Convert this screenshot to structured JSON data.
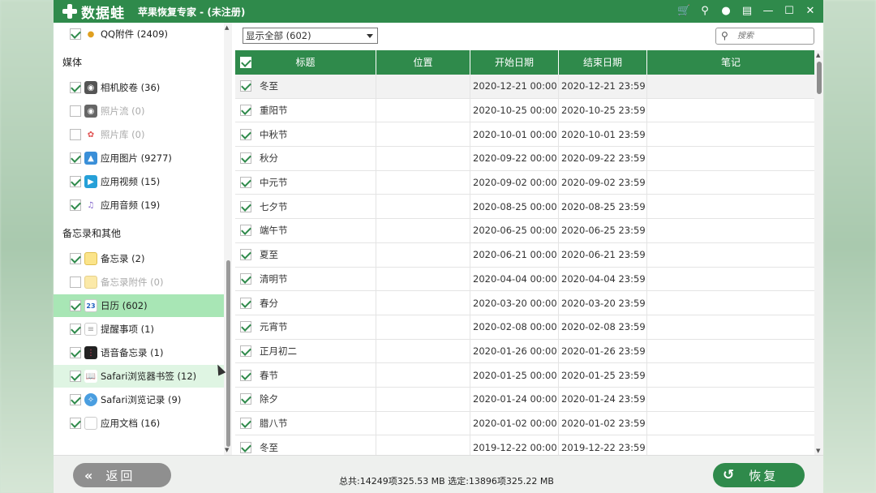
{
  "titlebar": {
    "logo_text": "数据蛙",
    "app_title": "苹果恢复专家 - (未注册)",
    "icons": [
      "cart-icon",
      "key-icon",
      "chat-icon",
      "feedback-icon",
      "minimize-icon",
      "maximize-icon",
      "close-icon"
    ]
  },
  "sidebar": {
    "qq_attachments": {
      "label": "QQ附件 (2409)",
      "checked": true
    },
    "media_header": "媒体",
    "media": [
      {
        "label": "相机胶卷 (36)",
        "checked": true,
        "disabled": false
      },
      {
        "label": "照片流 (0)",
        "checked": false,
        "disabled": true
      },
      {
        "label": "照片库 (0)",
        "checked": false,
        "disabled": true
      },
      {
        "label": "应用图片 (9277)",
        "checked": true,
        "disabled": false
      },
      {
        "label": "应用视频 (15)",
        "checked": true,
        "disabled": false
      },
      {
        "label": "应用音频 (19)",
        "checked": true,
        "disabled": false
      }
    ],
    "notes_header": "备忘录和其他",
    "notes": [
      {
        "label": "备忘录 (2)",
        "checked": true,
        "disabled": false
      },
      {
        "label": "备忘录附件 (0)",
        "checked": false,
        "disabled": true
      },
      {
        "label": "日历 (602)",
        "checked": true,
        "disabled": false,
        "selected": true
      },
      {
        "label": "提醒事项 (1)",
        "checked": true,
        "disabled": false
      },
      {
        "label": "语音备忘录 (1)",
        "checked": true,
        "disabled": false
      },
      {
        "label": "Safari浏览器书签 (12)",
        "checked": true,
        "disabled": false,
        "hover": true
      },
      {
        "label": "Safari浏览记录 (9)",
        "checked": true,
        "disabled": false
      },
      {
        "label": "应用文档 (16)",
        "checked": true,
        "disabled": false
      }
    ]
  },
  "toolbar": {
    "filter_value": "显示全部 (602)",
    "search_placeholder": "搜索"
  },
  "table": {
    "headers": {
      "title": "标题",
      "location": "位置",
      "start": "开始日期",
      "end": "结束日期",
      "note": "笔记"
    },
    "rows": [
      {
        "title": "冬至",
        "location": "",
        "start": "2020-12-21 00:00",
        "end": "2020-12-21 23:59",
        "note": ""
      },
      {
        "title": "重阳节",
        "location": "",
        "start": "2020-10-25 00:00",
        "end": "2020-10-25 23:59",
        "note": ""
      },
      {
        "title": "中秋节",
        "location": "",
        "start": "2020-10-01 00:00",
        "end": "2020-10-01 23:59",
        "note": ""
      },
      {
        "title": "秋分",
        "location": "",
        "start": "2020-09-22 00:00",
        "end": "2020-09-22 23:59",
        "note": ""
      },
      {
        "title": "中元节",
        "location": "",
        "start": "2020-09-02 00:00",
        "end": "2020-09-02 23:59",
        "note": ""
      },
      {
        "title": "七夕节",
        "location": "",
        "start": "2020-08-25 00:00",
        "end": "2020-08-25 23:59",
        "note": ""
      },
      {
        "title": "端午节",
        "location": "",
        "start": "2020-06-25 00:00",
        "end": "2020-06-25 23:59",
        "note": ""
      },
      {
        "title": "夏至",
        "location": "",
        "start": "2020-06-21 00:00",
        "end": "2020-06-21 23:59",
        "note": ""
      },
      {
        "title": "清明节",
        "location": "",
        "start": "2020-04-04 00:00",
        "end": "2020-04-04 23:59",
        "note": ""
      },
      {
        "title": "春分",
        "location": "",
        "start": "2020-03-20 00:00",
        "end": "2020-03-20 23:59",
        "note": ""
      },
      {
        "title": "元宵节",
        "location": "",
        "start": "2020-02-08 00:00",
        "end": "2020-02-08 23:59",
        "note": ""
      },
      {
        "title": "正月初二",
        "location": "",
        "start": "2020-01-26 00:00",
        "end": "2020-01-26 23:59",
        "note": ""
      },
      {
        "title": "春节",
        "location": "",
        "start": "2020-01-25 00:00",
        "end": "2020-01-25 23:59",
        "note": ""
      },
      {
        "title": "除夕",
        "location": "",
        "start": "2020-01-24 00:00",
        "end": "2020-01-24 23:59",
        "note": ""
      },
      {
        "title": "腊八节",
        "location": "",
        "start": "2020-01-02 00:00",
        "end": "2020-01-02 23:59",
        "note": ""
      },
      {
        "title": "冬至",
        "location": "",
        "start": "2019-12-22 00:00",
        "end": "2019-12-22 23:59",
        "note": ""
      }
    ]
  },
  "footer": {
    "back_label": "返回",
    "summary": "总共:14249项325.53 MB 选定:13896项325.22 MB",
    "restore_label": "恢复"
  },
  "colors": {
    "accent": "#2f8a4b",
    "selected_row": "#a8e6b5",
    "hover_row": "#dff5e3"
  }
}
